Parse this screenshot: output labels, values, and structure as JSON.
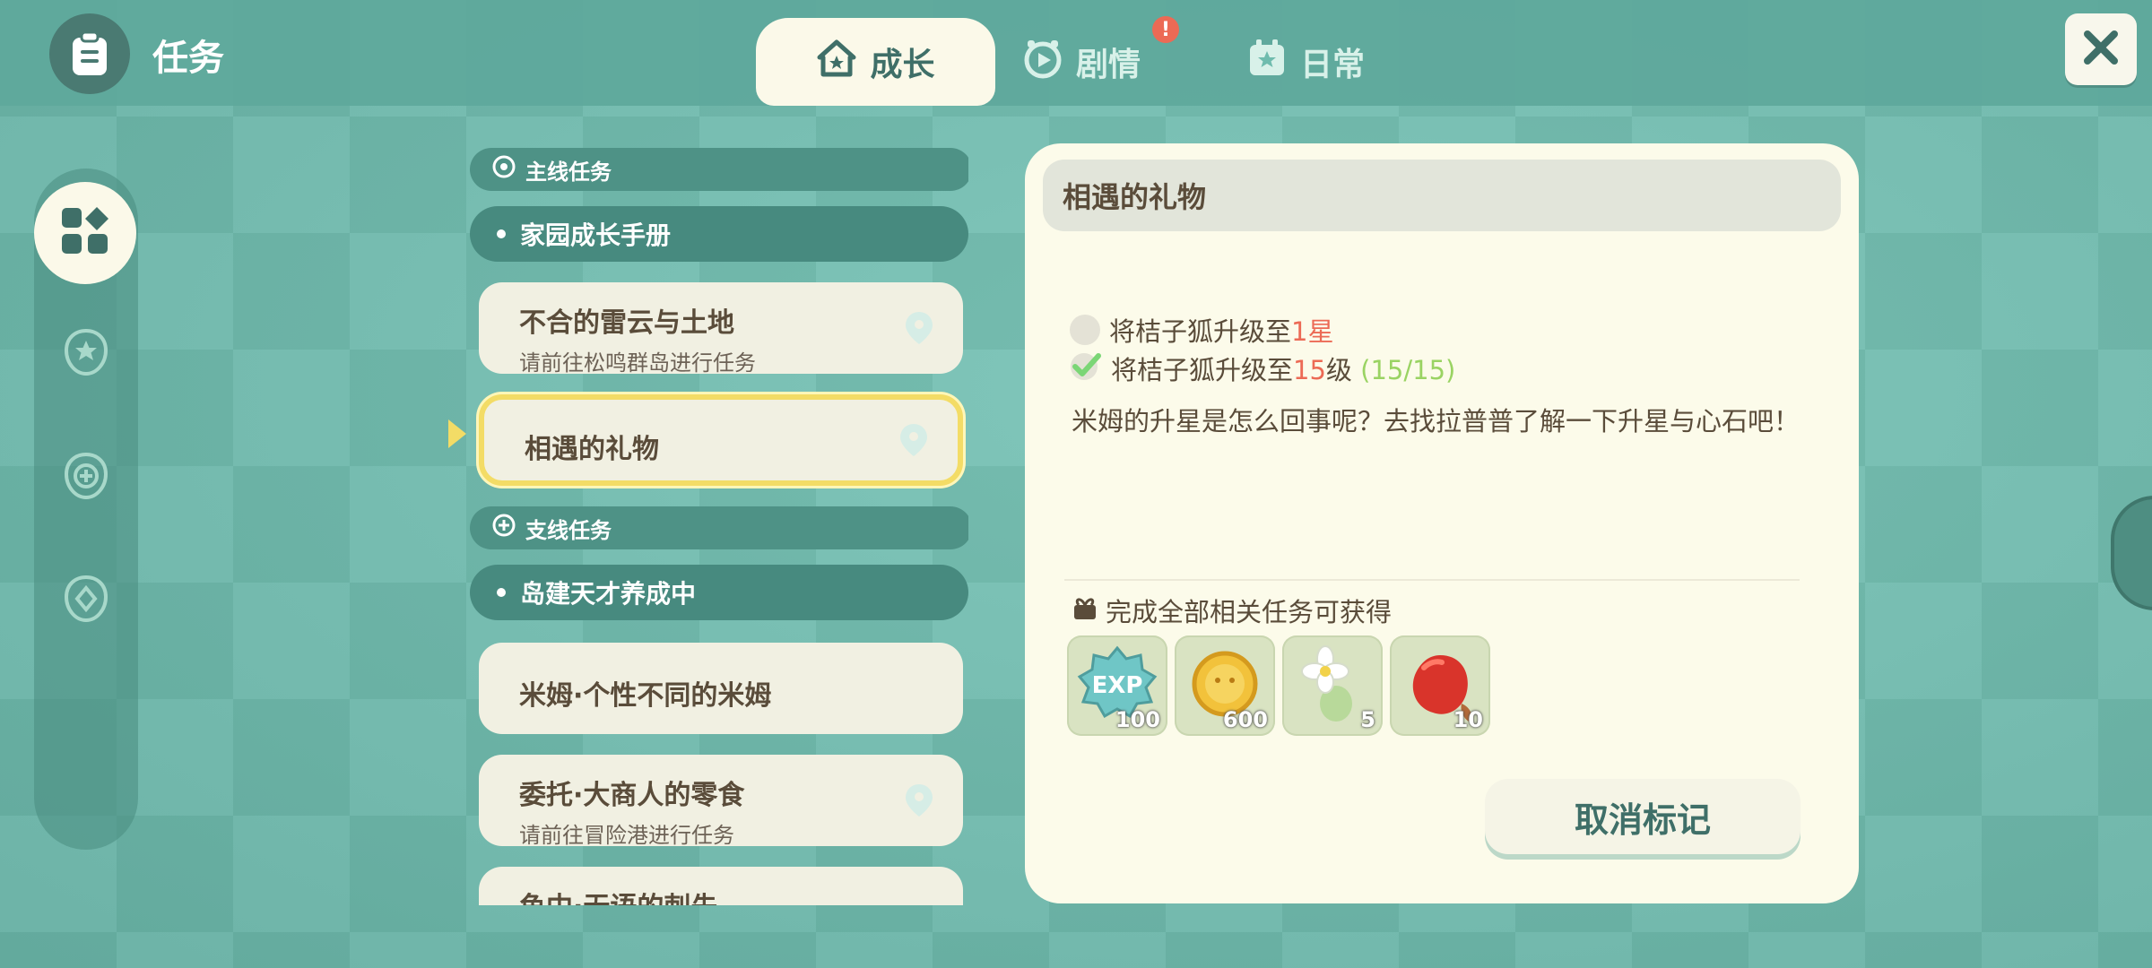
{
  "header": {
    "title": "任务",
    "tabs": [
      {
        "label": "成长",
        "icon": "house-icon",
        "active": true
      },
      {
        "label": "剧情",
        "icon": "film-icon",
        "badge": "!"
      },
      {
        "label": "日常",
        "icon": "calendar-star-icon"
      }
    ],
    "close_icon": "close-icon"
  },
  "sidebar": {
    "items": [
      {
        "icon": "grid-icon",
        "active": true
      },
      {
        "icon": "star-badge-icon"
      },
      {
        "icon": "plus-badge-icon"
      },
      {
        "icon": "diamond-badge-icon"
      }
    ]
  },
  "task_list": {
    "sections": [
      {
        "header": "主线任务",
        "groups": [
          {
            "label": "家园成长手册",
            "tasks": [
              {
                "title": "不合的雷云与土地",
                "subtitle": "请前往松鸣群岛进行任务"
              },
              {
                "title": "相遇的礼物",
                "subtitle": "",
                "selected": true
              }
            ]
          }
        ]
      },
      {
        "header": "支线任务",
        "groups": [
          {
            "label": "岛建天才养成中",
            "tasks": [
              {
                "title": "米姆·个性不同的米姆",
                "subtitle": ""
              },
              {
                "title": "委托·大商人的零食",
                "subtitle": "请前往冒险港进行任务"
              },
              {
                "title": "鱼中·无语的刺先",
                "subtitle": ""
              }
            ]
          }
        ]
      }
    ]
  },
  "detail": {
    "title": "相遇的礼物",
    "objectives": [
      {
        "prefix": "将桔子狐升级至",
        "value": "1星",
        "suffix": "",
        "progress": "",
        "done": false
      },
      {
        "prefix": "将桔子狐升级至",
        "value": "15",
        "suffix": "级",
        "progress": "(15/15)",
        "done": true
      }
    ],
    "description": "米姆的升星是怎么回事呢？去找拉普普了解一下升星与心石吧！",
    "reward_title": "完成全部相关任务可获得",
    "rewards": [
      {
        "name": "EXP",
        "count": "100",
        "icon": "exp-icon"
      },
      {
        "name": "coin",
        "count": "600",
        "icon": "gold-coin-icon"
      },
      {
        "name": "flower",
        "count": "5",
        "icon": "white-flower-icon"
      },
      {
        "name": "fruit",
        "count": "10",
        "icon": "red-fruit-icon"
      }
    ],
    "cancel_button": "取消标记"
  },
  "colors": {
    "accent": "#ec6a55",
    "progress": "#9ad363",
    "teal": "#3f6f68",
    "panel": "#fcfbea"
  }
}
